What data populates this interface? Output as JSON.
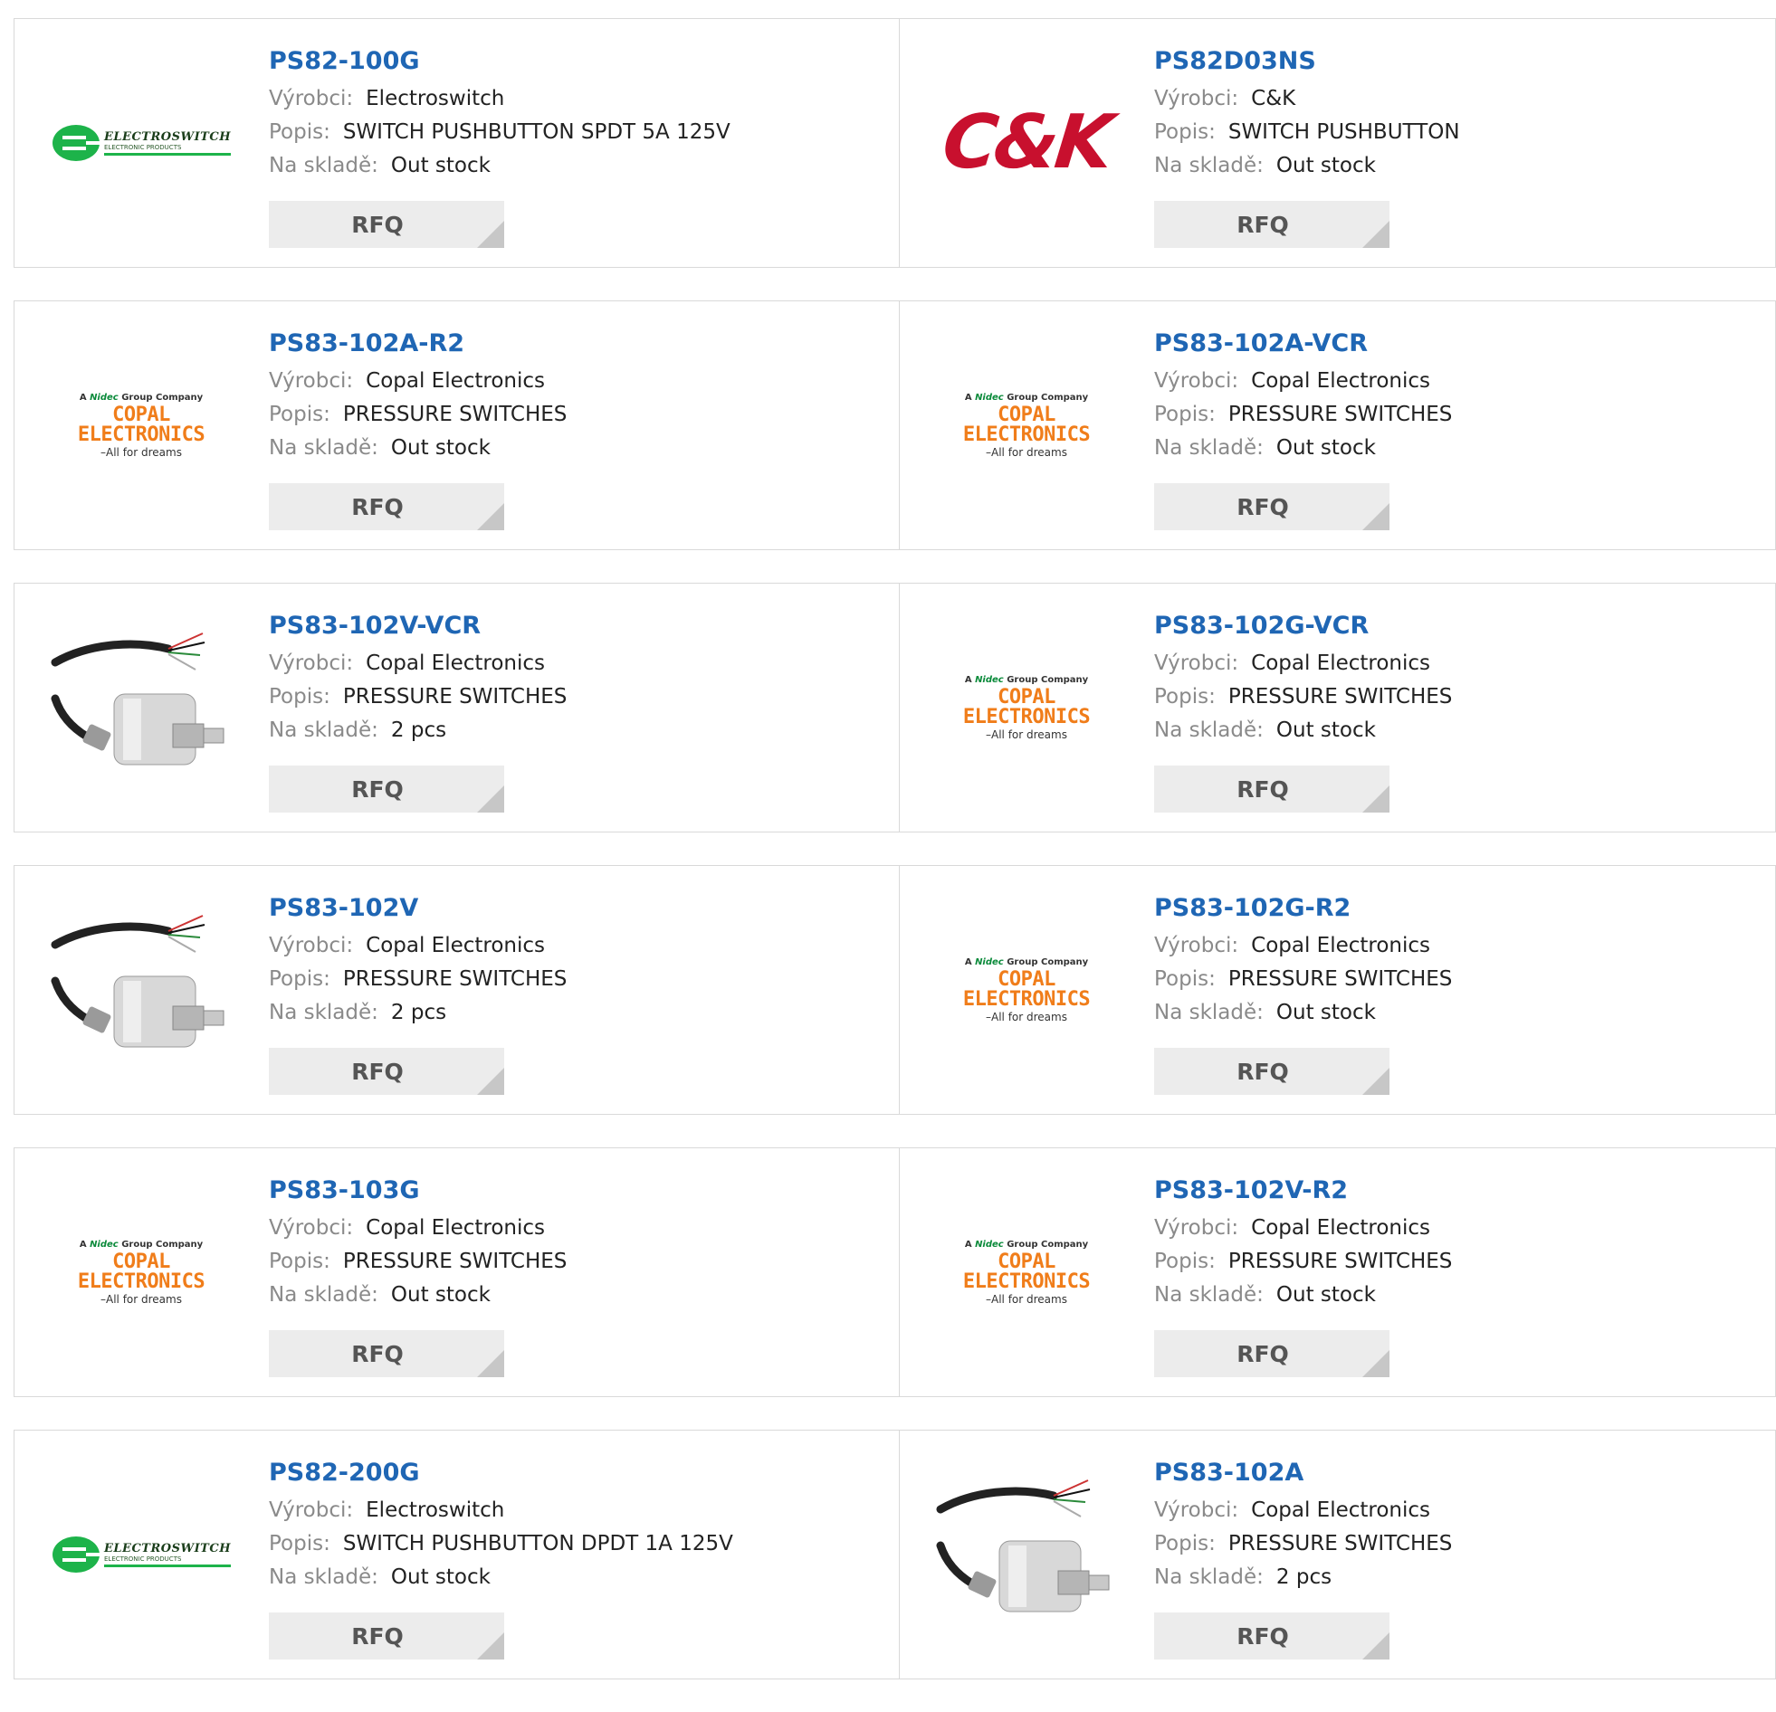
{
  "labels": {
    "manufacturer": "Výrobci:",
    "description": "Popis:",
    "stock": "Na skladě:",
    "rfq": "RFQ"
  },
  "logos": {
    "electroswitch": {
      "title": "ELECTROSWITCH",
      "subtitle": "ELECTRONIC PRODUCTS",
      "color": "#1db34a"
    },
    "ck": {
      "text": "C&K",
      "color": "#c8102e"
    },
    "copal": {
      "top_a": "A",
      "top_nidec": "Nidec",
      "top_rest": "Group Company",
      "main": "COPAL ELECTRONICS",
      "sub": "–All for dreams",
      "color": "#f07d1a"
    }
  },
  "rows": [
    {
      "left": {
        "part": "PS82-100G",
        "logo": "electroswitch",
        "manufacturer": "Electroswitch",
        "description": "SWITCH PUSHBUTTON SPDT 5A 125V",
        "stock": "Out stock"
      },
      "right": {
        "part": "PS82D03NS",
        "logo": "ck",
        "manufacturer": "C&K",
        "description": "SWITCH PUSHBUTTON",
        "stock": "Out stock"
      }
    },
    {
      "left": {
        "part": "PS83-102A-R2",
        "logo": "copal",
        "manufacturer": "Copal Electronics",
        "description": "PRESSURE SWITCHES",
        "stock": "Out stock"
      },
      "right": {
        "part": "PS83-102A-VCR",
        "logo": "copal",
        "manufacturer": "Copal Electronics",
        "description": "PRESSURE SWITCHES",
        "stock": "Out stock"
      }
    },
    {
      "left": {
        "part": "PS83-102V-VCR",
        "logo": "sensor",
        "manufacturer": "Copal Electronics",
        "description": "PRESSURE SWITCHES",
        "stock": "2 pcs"
      },
      "right": {
        "part": "PS83-102G-VCR",
        "logo": "copal",
        "manufacturer": "Copal Electronics",
        "description": "PRESSURE SWITCHES",
        "stock": "Out stock"
      }
    },
    {
      "left": {
        "part": "PS83-102V",
        "logo": "sensor",
        "manufacturer": "Copal Electronics",
        "description": "PRESSURE SWITCHES",
        "stock": "2 pcs"
      },
      "right": {
        "part": "PS83-102G-R2",
        "logo": "copal",
        "manufacturer": "Copal Electronics",
        "description": "PRESSURE SWITCHES",
        "stock": "Out stock"
      }
    },
    {
      "left": {
        "part": "PS83-103G",
        "logo": "copal",
        "manufacturer": "Copal Electronics",
        "description": "PRESSURE SWITCHES",
        "stock": "Out stock"
      },
      "right": {
        "part": "PS83-102V-R2",
        "logo": "copal",
        "manufacturer": "Copal Electronics",
        "description": "PRESSURE SWITCHES",
        "stock": "Out stock"
      }
    },
    {
      "left": {
        "part": "PS82-200G",
        "logo": "electroswitch",
        "manufacturer": "Electroswitch",
        "description": "SWITCH PUSHBUTTON DPDT 1A 125V",
        "stock": "Out stock"
      },
      "right": {
        "part": "PS83-102A",
        "logo": "sensor",
        "manufacturer": "Copal Electronics",
        "description": "PRESSURE SWITCHES",
        "stock": "2 pcs"
      }
    }
  ]
}
